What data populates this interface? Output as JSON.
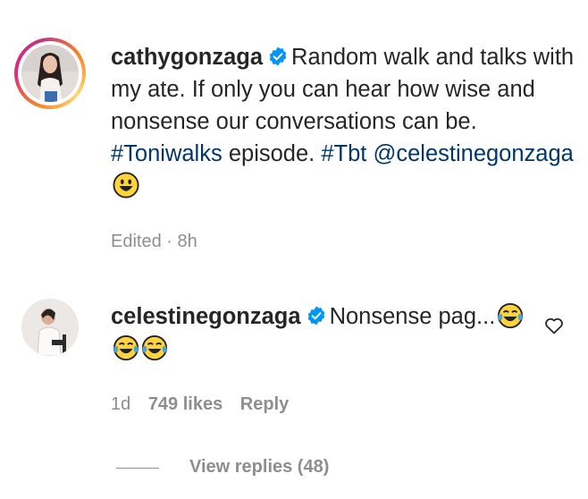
{
  "post": {
    "username": "cathygonzaga",
    "caption_text_1": "Random walk and talks with my ate. If only you can hear how wise and nonsense our conversations can be.",
    "hashtag_1": "#Toniwalks",
    "caption_text_2": "episode.",
    "hashtag_2": "#Tbt",
    "mention": "@celestinegonzaga",
    "emoji": "grinning-face",
    "edited_label": "Edited",
    "separator": " · ",
    "time": "8h"
  },
  "comment": {
    "username": "celestinegonzaga",
    "text": "Nonsense pag...",
    "emoji": "laughing-tears x3",
    "time": "1d",
    "likes": "749 likes",
    "reply_label": "Reply",
    "view_replies": "View replies (48)"
  },
  "colors": {
    "text": "#262626",
    "muted": "#8e8e8e",
    "link": "#00376b",
    "verified": "#0095f6"
  }
}
